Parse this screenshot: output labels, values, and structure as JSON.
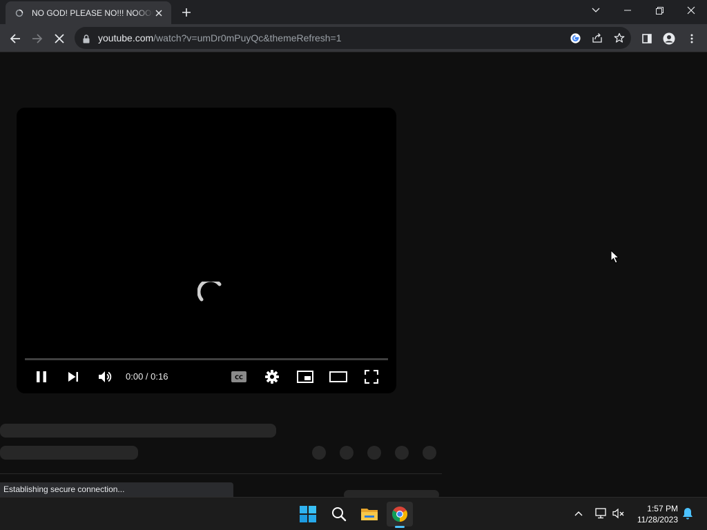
{
  "browser": {
    "tab": {
      "title": "NO GOD! PLEASE NO!!! NOOOOOOO",
      "favicon": "loading-globe-icon",
      "close_icon": "close-icon"
    },
    "new_tab_icon": "plus-icon",
    "window_controls": [
      "chevron-down-icon",
      "minimize-icon",
      "restore-icon",
      "close-icon"
    ],
    "toolbar": {
      "back_icon": "arrow-left-icon",
      "forward_icon": "arrow-right-icon",
      "stop_icon": "stop-loading-icon",
      "url_host": "youtube.com",
      "url_path": "/watch?v=umDr0mPuyQc&themeRefresh=1",
      "omnibox_icons": [
        "google-lens-icon",
        "share-icon",
        "star-icon"
      ],
      "right_icons": [
        "side-panel-icon",
        "profile-icon",
        "kebab-menu-icon"
      ]
    },
    "status_text": "Establishing secure connection..."
  },
  "player": {
    "time_current": "0:00",
    "time_separator": " / ",
    "time_total": "0:16",
    "progress": 0,
    "controls": [
      "pause-icon",
      "next-icon",
      "volume-icon",
      "captions-icon",
      "settings-icon",
      "miniplayer-icon",
      "theater-icon",
      "fullscreen-icon"
    ]
  },
  "taskbar": {
    "apps": [
      "windows-start-icon",
      "search-icon",
      "file-explorer-icon",
      "chrome-icon"
    ],
    "active_app": "chrome-icon",
    "tray_icons": [
      "chevron-up-icon",
      "network-icon",
      "volume-muted-icon",
      "notification-bell-icon"
    ],
    "time": "1:57 PM",
    "date": "11/28/2023"
  },
  "colors": {
    "page_bg": "#0f0f0f",
    "chrome_frame": "#202124",
    "chrome_toolbar": "#35363a",
    "accent": "#4cc2ff"
  }
}
